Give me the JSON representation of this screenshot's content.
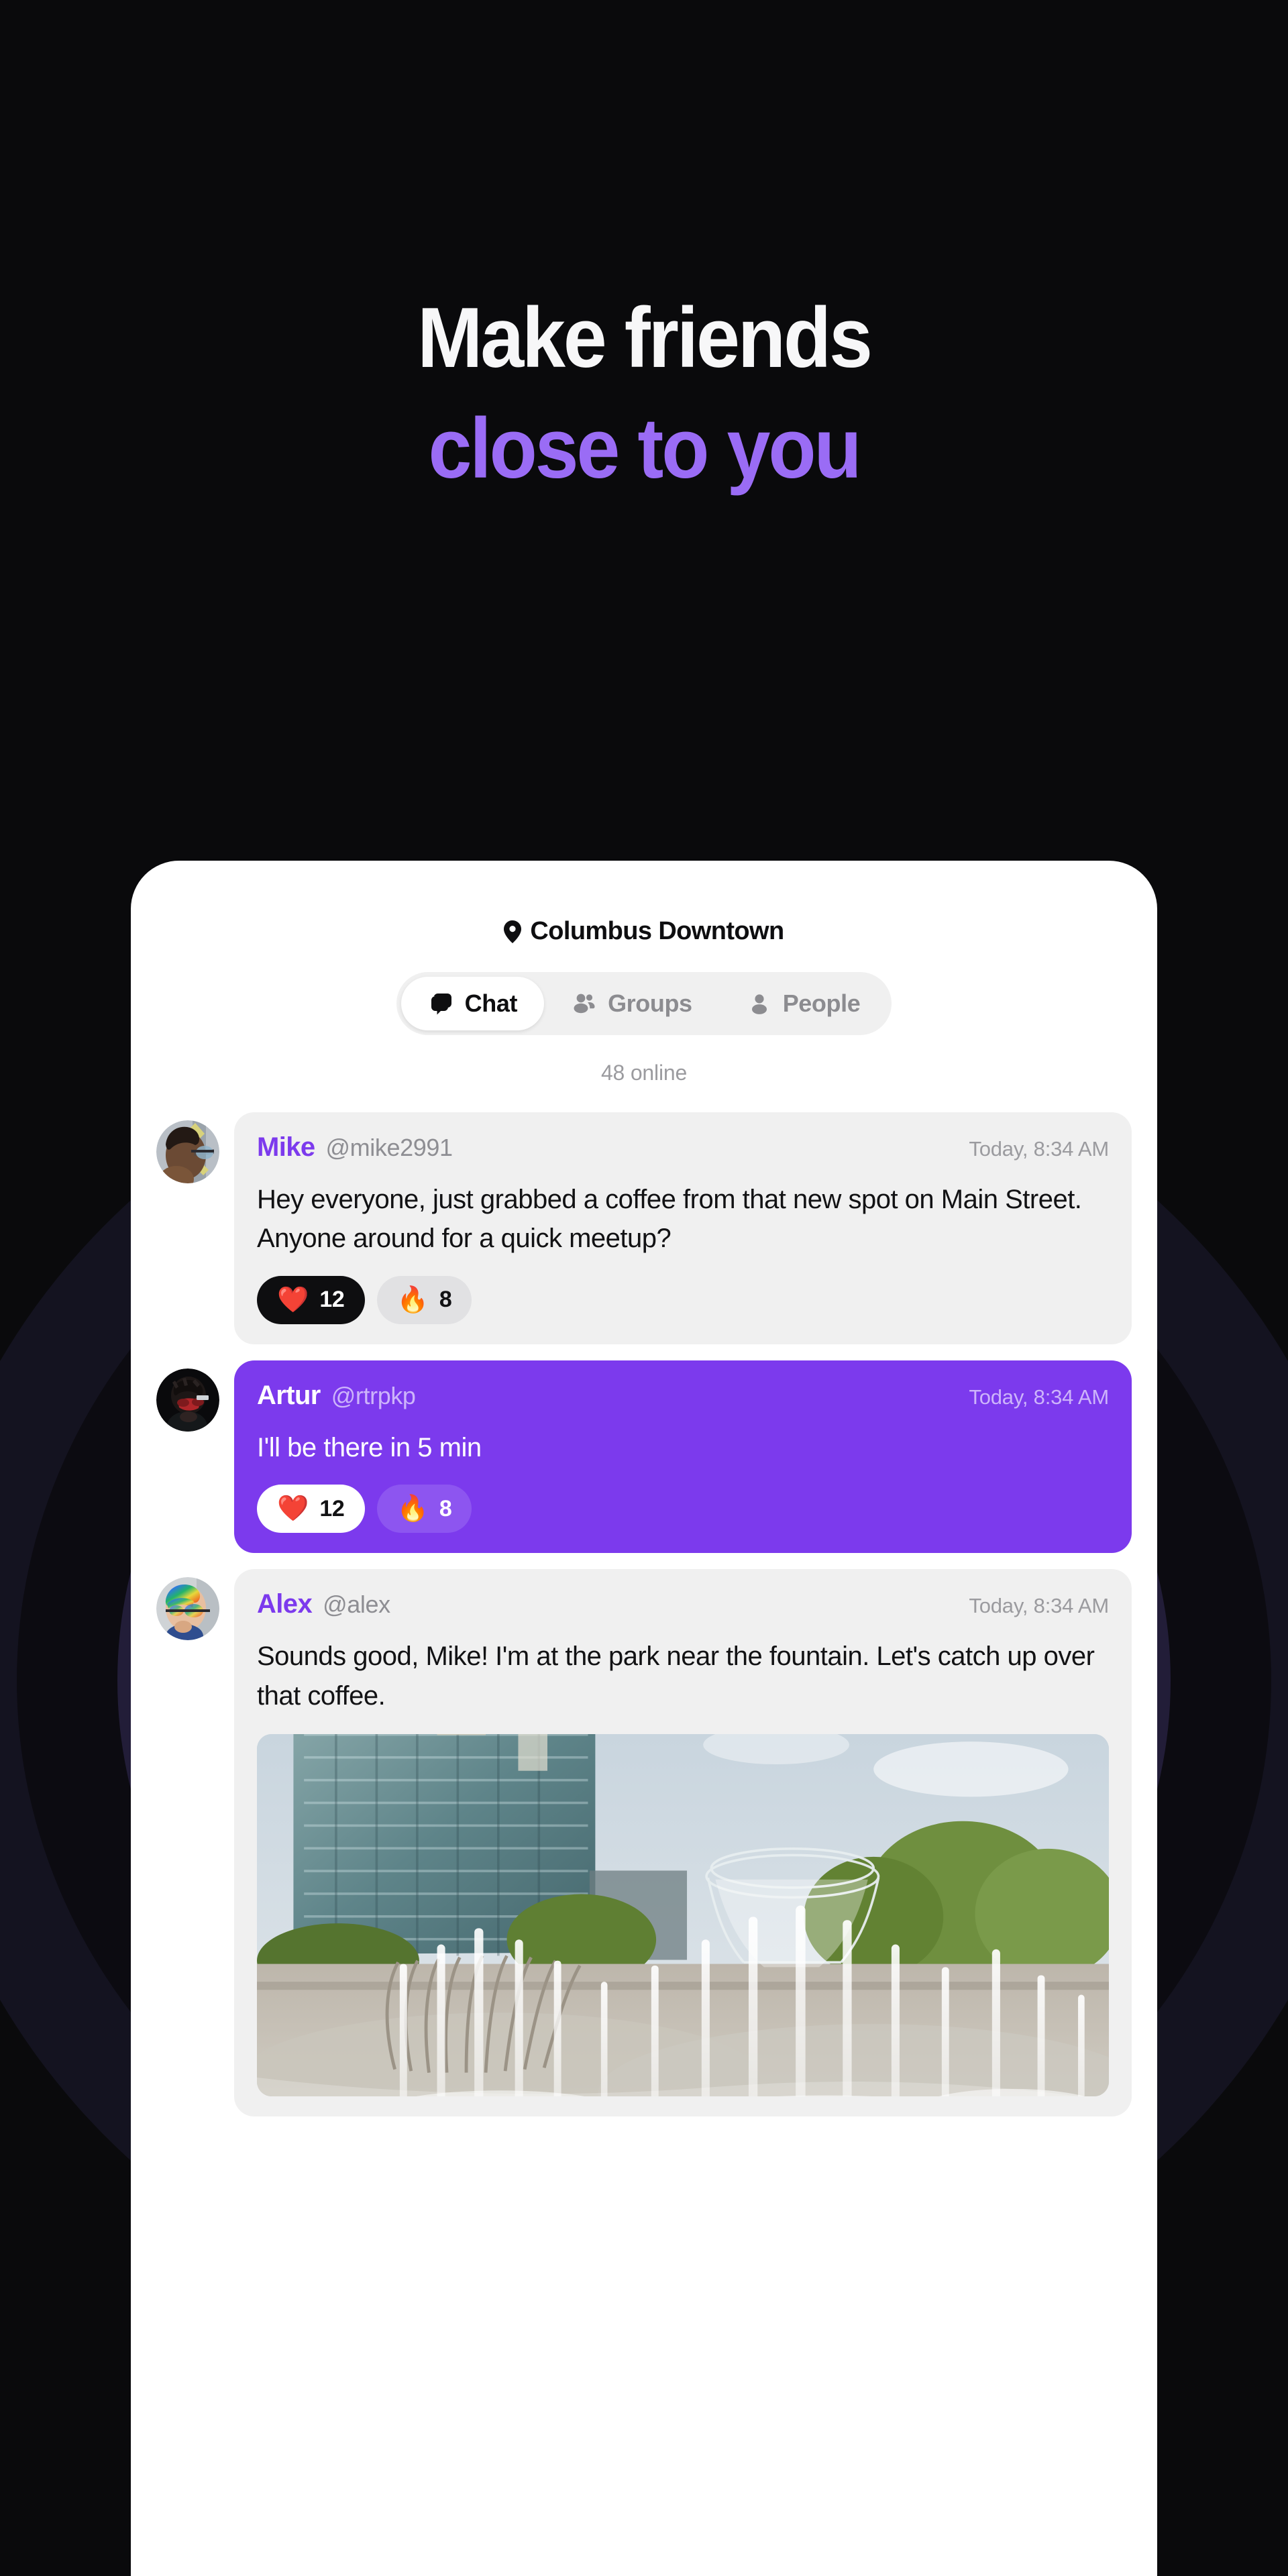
{
  "hero": {
    "line1": "Make friends",
    "line2": "close to you",
    "accent_color": "#9a6cf5",
    "background_color": "#0a0a0c"
  },
  "app": {
    "location": {
      "icon": "location-pin-icon",
      "name": "Columbus Downtown"
    },
    "tabs": [
      {
        "id": "chat",
        "label": "Chat",
        "icon": "chat-bubbles-icon",
        "active": true
      },
      {
        "id": "groups",
        "label": "Groups",
        "icon": "group-people-icon",
        "active": false
      },
      {
        "id": "people",
        "label": "People",
        "icon": "person-icon",
        "active": false
      }
    ],
    "online_status": "48 online",
    "messages": [
      {
        "id": "msg-mike",
        "name": "Mike",
        "handle": "@mike2991",
        "time": "Today, 8:34 AM",
        "text": "Hey everyone, just grabbed a coffee from that new spot on Main Street. Anyone around for a quick meetup?",
        "own": false,
        "avatar": "avatar-mike",
        "reactions": [
          {
            "emoji": "❤️",
            "count": "12",
            "selected": true
          },
          {
            "emoji": "🔥",
            "count": "8",
            "selected": false
          }
        ],
        "photo": null
      },
      {
        "id": "msg-artur",
        "name": "Artur",
        "handle": "@rtrpkp",
        "time": "Today, 8:34 AM",
        "text": "I'll be there in 5 min",
        "own": true,
        "avatar": "avatar-artur",
        "reactions": [
          {
            "emoji": "❤️",
            "count": "12",
            "selected": true
          },
          {
            "emoji": "🔥",
            "count": "8",
            "selected": false
          }
        ],
        "photo": null
      },
      {
        "id": "msg-alex",
        "name": "Alex",
        "handle": "@alex",
        "time": "Today, 8:34 AM",
        "text": "Sounds good, Mike! I'm at the park near the fountain. Let's catch up over that coffee.",
        "own": false,
        "avatar": "avatar-alex",
        "reactions": [],
        "photo": "park-fountain-photo"
      }
    ]
  },
  "theme": {
    "brand_purple": "#7c3aed",
    "bubble_gray": "#f0f0f0",
    "chip_gray": "#e1e1e3",
    "muted_text": "#9b9b9f"
  }
}
